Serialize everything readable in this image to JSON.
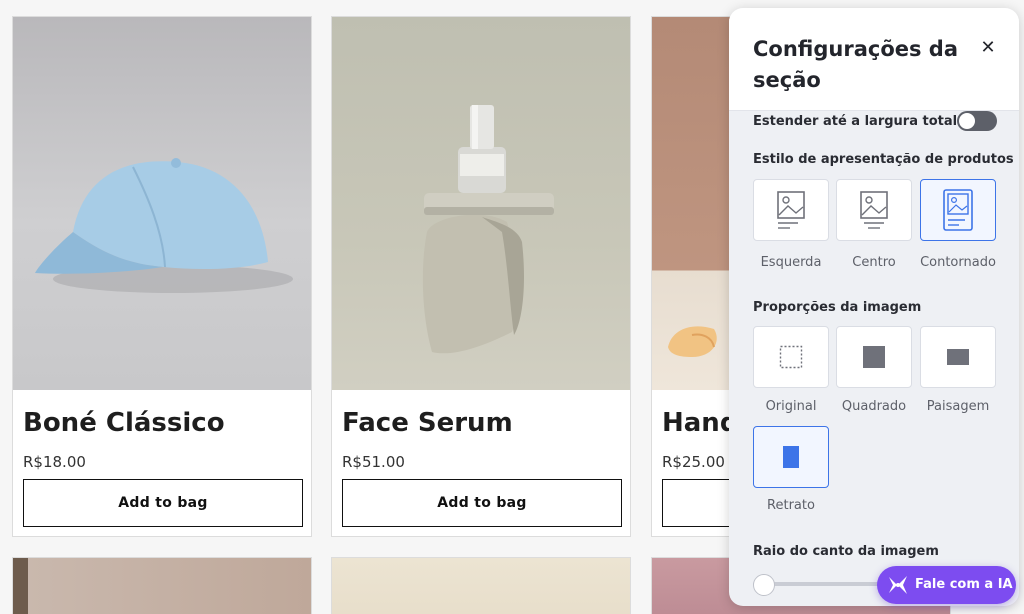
{
  "products": [
    {
      "title": "Boné Clássico",
      "price": "R$18.00",
      "button": "Add to bag"
    },
    {
      "title": "Face Serum",
      "price": "R$51.00",
      "button": "Add to bag"
    },
    {
      "title": "Hand",
      "price": "R$25.00",
      "button": ""
    }
  ],
  "panel": {
    "title": "Configurações da seção",
    "stretch_label": "Estender até a largura total",
    "stretch_on": false,
    "style_label": "Estilo de apresentação de produtos",
    "style_options": [
      "Esquerda",
      "Centro",
      "Contornado"
    ],
    "style_selected": "Contornado",
    "ratio_label": "Proporções da imagem",
    "ratio_options": [
      "Original",
      "Quadrado",
      "Paisagem",
      "Retrato"
    ],
    "ratio_selected": "Retrato",
    "radius_label": "Raio do canto da imagem",
    "radius_value": 0
  },
  "ai_button": "Fale com a IA",
  "colors": {
    "accent": "#3d74e8",
    "ai": "#7d4cf0",
    "icon_gray": "#6f717a"
  }
}
